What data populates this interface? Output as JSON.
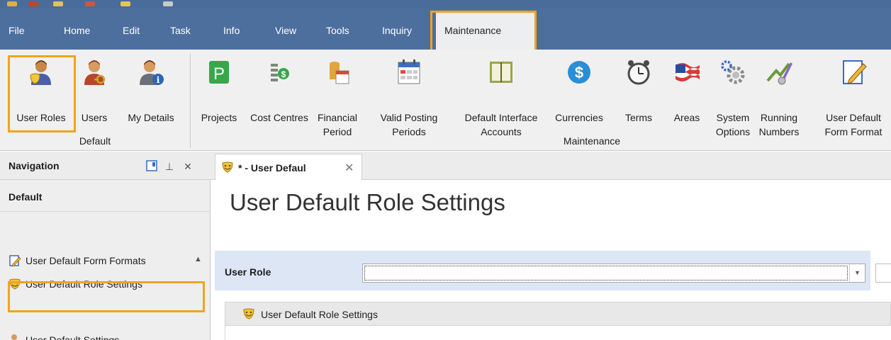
{
  "menu": {
    "items": [
      "File",
      "Home",
      "Edit",
      "Task",
      "Info",
      "View",
      "Tools",
      "Inquiry"
    ],
    "active": "Maintenance"
  },
  "ribbon": {
    "default_group": {
      "label": "Default",
      "buttons": [
        "User Roles",
        "Users",
        "My Details"
      ]
    },
    "maintenance_group": {
      "label": "Maintenance",
      "buttons": [
        {
          "line1": "Projects",
          "line2": ""
        },
        {
          "line1": "Cost Centres",
          "line2": ""
        },
        {
          "line1": "Financial",
          "line2": "Period"
        },
        {
          "line1": "Valid Posting",
          "line2": "Periods"
        },
        {
          "line1": "Default Interface",
          "line2": "Accounts"
        },
        {
          "line1": "Currencies",
          "line2": ""
        },
        {
          "line1": "Terms",
          "line2": ""
        },
        {
          "line1": "Areas",
          "line2": ""
        },
        {
          "line1": "System",
          "line2": "Options"
        },
        {
          "line1": "Running",
          "line2": "Numbers"
        },
        {
          "line1": "User Default",
          "line2": "Form Format"
        }
      ]
    }
  },
  "navigation": {
    "title": "Navigation",
    "group": "Default",
    "items": [
      "User Default Form Formats",
      "User Default Role Settings",
      "User Default Settings"
    ]
  },
  "document": {
    "tab_label": "* - User Defaul",
    "page_title": "User Default Role Settings",
    "role_label": "User Role",
    "role_value": "",
    "section_title": "User Default Role Settings"
  },
  "colors": {
    "menu_bar": "#4d6f9e",
    "highlight": "#f2a31c",
    "ribbon_bg": "#f0f0f0",
    "role_bar": "#dce6f4"
  }
}
